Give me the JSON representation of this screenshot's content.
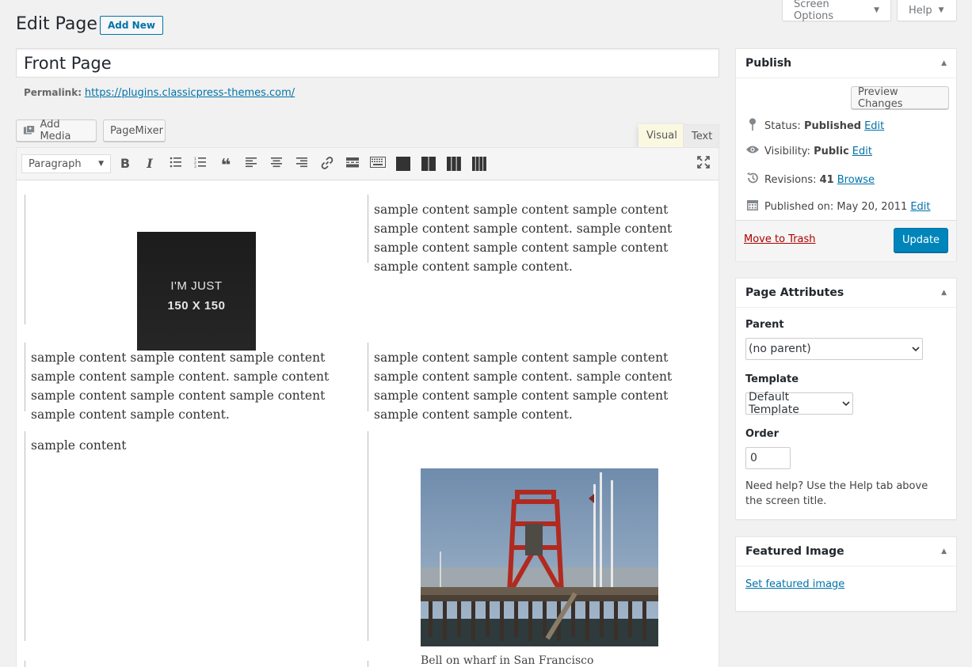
{
  "screen_meta": {
    "screen_options": "Screen Options",
    "help": "Help"
  },
  "header": {
    "title": "Edit Page",
    "add_new": "Add New"
  },
  "post": {
    "title": "Front Page",
    "permalink_label": "Permalink:",
    "permalink_url": "https://plugins.classicpress-themes.com/"
  },
  "media_buttons": {
    "add_media": "Add Media",
    "pagemixer": "PageMixer"
  },
  "editor_tabs": {
    "visual": "Visual",
    "text": "Text"
  },
  "toolbar": {
    "format_select": "Paragraph"
  },
  "content": {
    "image_placeholder_line1": "I'M JUST",
    "image_placeholder_line2": "150 X 150",
    "block1_right": "sample content sample content sample content sample content sample content. sample content sample content sample content sample content sample content sample content.",
    "block2_left": "sample content sample content sample content sample content sample content. sample content sample content sample content sample content sample content sample content.",
    "block2_right": "sample content sample content sample content sample content sample content. sample content sample content sample content sample content sample content sample content.",
    "block3_left": "sample content",
    "photo_caption": "Bell on wharf in San Francisco"
  },
  "publish": {
    "heading": "Publish",
    "preview_changes": "Preview Changes",
    "status_label": "Status:",
    "status_value": "Published",
    "visibility_label": "Visibility:",
    "visibility_value": "Public",
    "revisions_label": "Revisions:",
    "revisions_value": "41",
    "published_on": "Published on: May 20, 2011",
    "edit": "Edit",
    "browse": "Browse",
    "move_to_trash": "Move to Trash",
    "update": "Update"
  },
  "page_attributes": {
    "heading": "Page Attributes",
    "parent_label": "Parent",
    "parent_value": "(no parent)",
    "template_label": "Template",
    "template_value": "Default Template",
    "order_label": "Order",
    "order_value": "0",
    "help_text": "Need help? Use the Help tab above the screen title."
  },
  "featured_image": {
    "heading": "Featured Image",
    "set_link": "Set featured image"
  }
}
